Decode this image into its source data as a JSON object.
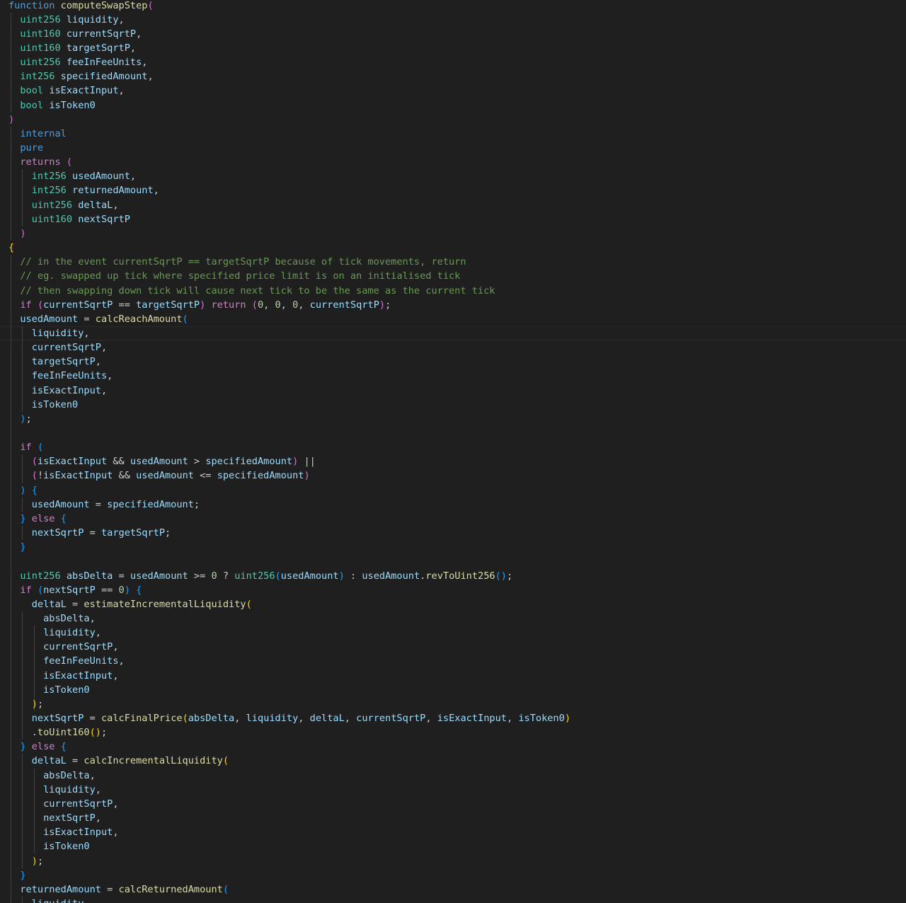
{
  "theme": {
    "background": "#1f1f1f",
    "colors": {
      "kw": "#569cd6",
      "ctrl": "#c586c0",
      "type": "#4ec9b0",
      "var": "#9cdcfe",
      "fn": "#dcdcaa",
      "num": "#b5cea8",
      "cmt": "#6a9955",
      "p1": "#da70d6",
      "p2": "#179fff",
      "p3": "#ffd700",
      "txt": "#cccccc"
    }
  },
  "editor": {
    "lines": [
      [
        [
          "kw",
          "function"
        ],
        [
          "txt",
          " "
        ],
        [
          "fn",
          "computeSwapStep"
        ],
        [
          "p1",
          "("
        ]
      ],
      [
        [
          "txt",
          "  "
        ],
        [
          "type",
          "uint256"
        ],
        [
          "txt",
          " "
        ],
        [
          "var",
          "liquidity"
        ],
        [
          "txt",
          ","
        ]
      ],
      [
        [
          "txt",
          "  "
        ],
        [
          "type",
          "uint160"
        ],
        [
          "txt",
          " "
        ],
        [
          "var",
          "currentSqrtP"
        ],
        [
          "txt",
          ","
        ]
      ],
      [
        [
          "txt",
          "  "
        ],
        [
          "type",
          "uint160"
        ],
        [
          "txt",
          " "
        ],
        [
          "var",
          "targetSqrtP"
        ],
        [
          "txt",
          ","
        ]
      ],
      [
        [
          "txt",
          "  "
        ],
        [
          "type",
          "uint256"
        ],
        [
          "txt",
          " "
        ],
        [
          "var",
          "feeInFeeUnits"
        ],
        [
          "txt",
          ","
        ]
      ],
      [
        [
          "txt",
          "  "
        ],
        [
          "type",
          "int256"
        ],
        [
          "txt",
          " "
        ],
        [
          "var",
          "specifiedAmount"
        ],
        [
          "txt",
          ","
        ]
      ],
      [
        [
          "txt",
          "  "
        ],
        [
          "type",
          "bool"
        ],
        [
          "txt",
          " "
        ],
        [
          "var",
          "isExactInput"
        ],
        [
          "txt",
          ","
        ]
      ],
      [
        [
          "txt",
          "  "
        ],
        [
          "type",
          "bool"
        ],
        [
          "txt",
          " "
        ],
        [
          "var",
          "isToken0"
        ]
      ],
      [
        [
          "p1",
          ")"
        ]
      ],
      [
        [
          "txt",
          "  "
        ],
        [
          "kw",
          "internal"
        ]
      ],
      [
        [
          "txt",
          "  "
        ],
        [
          "kw",
          "pure"
        ]
      ],
      [
        [
          "txt",
          "  "
        ],
        [
          "ctrl",
          "returns"
        ],
        [
          "txt",
          " "
        ],
        [
          "p1",
          "("
        ]
      ],
      [
        [
          "txt",
          "    "
        ],
        [
          "type",
          "int256"
        ],
        [
          "txt",
          " "
        ],
        [
          "var",
          "usedAmount"
        ],
        [
          "txt",
          ","
        ]
      ],
      [
        [
          "txt",
          "    "
        ],
        [
          "type",
          "int256"
        ],
        [
          "txt",
          " "
        ],
        [
          "var",
          "returnedAmount"
        ],
        [
          "txt",
          ","
        ]
      ],
      [
        [
          "txt",
          "    "
        ],
        [
          "type",
          "uint256"
        ],
        [
          "txt",
          " "
        ],
        [
          "var",
          "deltaL"
        ],
        [
          "txt",
          ","
        ]
      ],
      [
        [
          "txt",
          "    "
        ],
        [
          "type",
          "uint160"
        ],
        [
          "txt",
          " "
        ],
        [
          "var",
          "nextSqrtP"
        ]
      ],
      [
        [
          "txt",
          "  "
        ],
        [
          "p1",
          ")"
        ]
      ],
      [
        [
          "p3",
          "{"
        ]
      ],
      [
        [
          "txt",
          "  "
        ],
        [
          "cmt",
          "// in the event currentSqrtP == targetSqrtP because of tick movements, return"
        ]
      ],
      [
        [
          "txt",
          "  "
        ],
        [
          "cmt",
          "// eg. swapped up tick where specified price limit is on an initialised tick"
        ]
      ],
      [
        [
          "txt",
          "  "
        ],
        [
          "cmt",
          "// then swapping down tick will cause next tick to be the same as the current tick"
        ]
      ],
      [
        [
          "txt",
          "  "
        ],
        [
          "ctrl",
          "if"
        ],
        [
          "txt",
          " "
        ],
        [
          "p1",
          "("
        ],
        [
          "var",
          "currentSqrtP"
        ],
        [
          "txt",
          " == "
        ],
        [
          "var",
          "targetSqrtP"
        ],
        [
          "p1",
          ")"
        ],
        [
          "txt",
          " "
        ],
        [
          "ctrl",
          "return"
        ],
        [
          "txt",
          " "
        ],
        [
          "p1",
          "("
        ],
        [
          "num",
          "0"
        ],
        [
          "txt",
          ", "
        ],
        [
          "num",
          "0"
        ],
        [
          "txt",
          ", "
        ],
        [
          "num",
          "0"
        ],
        [
          "txt",
          ", "
        ],
        [
          "var",
          "currentSqrtP"
        ],
        [
          "p1",
          ")"
        ],
        [
          "txt",
          ";"
        ]
      ],
      [
        [
          "txt",
          "  "
        ],
        [
          "var",
          "usedAmount"
        ],
        [
          "txt",
          " = "
        ],
        [
          "fn",
          "calcReachAmount"
        ],
        [
          "p2",
          "("
        ]
      ],
      [
        [
          "txt",
          "    "
        ],
        [
          "var",
          "liquidity"
        ],
        [
          "txt",
          ","
        ]
      ],
      [
        [
          "txt",
          "    "
        ],
        [
          "var",
          "currentSqrtP"
        ],
        [
          "txt",
          ","
        ]
      ],
      [
        [
          "txt",
          "    "
        ],
        [
          "var",
          "targetSqrtP"
        ],
        [
          "txt",
          ","
        ]
      ],
      [
        [
          "txt",
          "    "
        ],
        [
          "var",
          "feeInFeeUnits"
        ],
        [
          "txt",
          ","
        ]
      ],
      [
        [
          "txt",
          "    "
        ],
        [
          "var",
          "isExactInput"
        ],
        [
          "txt",
          ","
        ]
      ],
      [
        [
          "txt",
          "    "
        ],
        [
          "var",
          "isToken0"
        ]
      ],
      [
        [
          "txt",
          "  "
        ],
        [
          "p2",
          ")"
        ],
        [
          "txt",
          ";"
        ]
      ],
      [],
      [
        [
          "txt",
          "  "
        ],
        [
          "ctrl",
          "if"
        ],
        [
          "txt",
          " "
        ],
        [
          "p2",
          "("
        ]
      ],
      [
        [
          "txt",
          "    "
        ],
        [
          "p1",
          "("
        ],
        [
          "var",
          "isExactInput"
        ],
        [
          "txt",
          " && "
        ],
        [
          "var",
          "usedAmount"
        ],
        [
          "txt",
          " > "
        ],
        [
          "var",
          "specifiedAmount"
        ],
        [
          "p1",
          ")"
        ],
        [
          "txt",
          " ||"
        ]
      ],
      [
        [
          "txt",
          "    "
        ],
        [
          "p1",
          "("
        ],
        [
          "txt",
          "!"
        ],
        [
          "var",
          "isExactInput"
        ],
        [
          "txt",
          " && "
        ],
        [
          "var",
          "usedAmount"
        ],
        [
          "txt",
          " <= "
        ],
        [
          "var",
          "specifiedAmount"
        ],
        [
          "p1",
          ")"
        ]
      ],
      [
        [
          "txt",
          "  "
        ],
        [
          "p2",
          ")"
        ],
        [
          "txt",
          " "
        ],
        [
          "p2",
          "{"
        ]
      ],
      [
        [
          "txt",
          "    "
        ],
        [
          "var",
          "usedAmount"
        ],
        [
          "txt",
          " = "
        ],
        [
          "var",
          "specifiedAmount"
        ],
        [
          "txt",
          ";"
        ]
      ],
      [
        [
          "txt",
          "  "
        ],
        [
          "p2",
          "}"
        ],
        [
          "txt",
          " "
        ],
        [
          "ctrl",
          "else"
        ],
        [
          "txt",
          " "
        ],
        [
          "p2",
          "{"
        ]
      ],
      [
        [
          "txt",
          "    "
        ],
        [
          "var",
          "nextSqrtP"
        ],
        [
          "txt",
          " = "
        ],
        [
          "var",
          "targetSqrtP"
        ],
        [
          "txt",
          ";"
        ]
      ],
      [
        [
          "txt",
          "  "
        ],
        [
          "p2",
          "}"
        ]
      ],
      [],
      [
        [
          "txt",
          "  "
        ],
        [
          "type",
          "uint256"
        ],
        [
          "txt",
          " "
        ],
        [
          "var",
          "absDelta"
        ],
        [
          "txt",
          " = "
        ],
        [
          "var",
          "usedAmount"
        ],
        [
          "txt",
          " >= "
        ],
        [
          "num",
          "0"
        ],
        [
          "txt",
          " ? "
        ],
        [
          "type",
          "uint256"
        ],
        [
          "p2",
          "("
        ],
        [
          "var",
          "usedAmount"
        ],
        [
          "p2",
          ")"
        ],
        [
          "txt",
          " : "
        ],
        [
          "var",
          "usedAmount"
        ],
        [
          "txt",
          "."
        ],
        [
          "fn",
          "revToUint256"
        ],
        [
          "p2",
          "()"
        ],
        [
          "txt",
          ";"
        ]
      ],
      [
        [
          "txt",
          "  "
        ],
        [
          "ctrl",
          "if"
        ],
        [
          "txt",
          " "
        ],
        [
          "p2",
          "("
        ],
        [
          "var",
          "nextSqrtP"
        ],
        [
          "txt",
          " == "
        ],
        [
          "num",
          "0"
        ],
        [
          "p2",
          ")"
        ],
        [
          "txt",
          " "
        ],
        [
          "p2",
          "{"
        ]
      ],
      [
        [
          "txt",
          "    "
        ],
        [
          "var",
          "deltaL"
        ],
        [
          "txt",
          " = "
        ],
        [
          "fn",
          "estimateIncrementalLiquidity"
        ],
        [
          "p3",
          "("
        ]
      ],
      [
        [
          "txt",
          "      "
        ],
        [
          "var",
          "absDelta"
        ],
        [
          "txt",
          ","
        ]
      ],
      [
        [
          "txt",
          "      "
        ],
        [
          "var",
          "liquidity"
        ],
        [
          "txt",
          ","
        ]
      ],
      [
        [
          "txt",
          "      "
        ],
        [
          "var",
          "currentSqrtP"
        ],
        [
          "txt",
          ","
        ]
      ],
      [
        [
          "txt",
          "      "
        ],
        [
          "var",
          "feeInFeeUnits"
        ],
        [
          "txt",
          ","
        ]
      ],
      [
        [
          "txt",
          "      "
        ],
        [
          "var",
          "isExactInput"
        ],
        [
          "txt",
          ","
        ]
      ],
      [
        [
          "txt",
          "      "
        ],
        [
          "var",
          "isToken0"
        ]
      ],
      [
        [
          "txt",
          "    "
        ],
        [
          "p3",
          ")"
        ],
        [
          "txt",
          ";"
        ]
      ],
      [
        [
          "txt",
          "    "
        ],
        [
          "var",
          "nextSqrtP"
        ],
        [
          "txt",
          " = "
        ],
        [
          "fn",
          "calcFinalPrice"
        ],
        [
          "p3",
          "("
        ],
        [
          "var",
          "absDelta"
        ],
        [
          "txt",
          ", "
        ],
        [
          "var",
          "liquidity"
        ],
        [
          "txt",
          ", "
        ],
        [
          "var",
          "deltaL"
        ],
        [
          "txt",
          ", "
        ],
        [
          "var",
          "currentSqrtP"
        ],
        [
          "txt",
          ", "
        ],
        [
          "var",
          "isExactInput"
        ],
        [
          "txt",
          ", "
        ],
        [
          "var",
          "isToken0"
        ],
        [
          "p3",
          ")"
        ]
      ],
      [
        [
          "txt",
          "    ."
        ],
        [
          "fn",
          "toUint160"
        ],
        [
          "p3",
          "()"
        ],
        [
          "txt",
          ";"
        ]
      ],
      [
        [
          "txt",
          "  "
        ],
        [
          "p2",
          "}"
        ],
        [
          "txt",
          " "
        ],
        [
          "ctrl",
          "else"
        ],
        [
          "txt",
          " "
        ],
        [
          "p2",
          "{"
        ]
      ],
      [
        [
          "txt",
          "    "
        ],
        [
          "var",
          "deltaL"
        ],
        [
          "txt",
          " = "
        ],
        [
          "fn",
          "calcIncrementalLiquidity"
        ],
        [
          "p3",
          "("
        ]
      ],
      [
        [
          "txt",
          "      "
        ],
        [
          "var",
          "absDelta"
        ],
        [
          "txt",
          ","
        ]
      ],
      [
        [
          "txt",
          "      "
        ],
        [
          "var",
          "liquidity"
        ],
        [
          "txt",
          ","
        ]
      ],
      [
        [
          "txt",
          "      "
        ],
        [
          "var",
          "currentSqrtP"
        ],
        [
          "txt",
          ","
        ]
      ],
      [
        [
          "txt",
          "      "
        ],
        [
          "var",
          "nextSqrtP"
        ],
        [
          "txt",
          ","
        ]
      ],
      [
        [
          "txt",
          "      "
        ],
        [
          "var",
          "isExactInput"
        ],
        [
          "txt",
          ","
        ]
      ],
      [
        [
          "txt",
          "      "
        ],
        [
          "var",
          "isToken0"
        ]
      ],
      [
        [
          "txt",
          "    "
        ],
        [
          "p3",
          ")"
        ],
        [
          "txt",
          ";"
        ]
      ],
      [
        [
          "txt",
          "  "
        ],
        [
          "p2",
          "}"
        ]
      ],
      [
        [
          "txt",
          "  "
        ],
        [
          "var",
          "returnedAmount"
        ],
        [
          "txt",
          " = "
        ],
        [
          "fn",
          "calcReturnedAmount"
        ],
        [
          "p2",
          "("
        ]
      ],
      [
        [
          "txt",
          "    "
        ],
        [
          "var",
          "liquidity"
        ],
        [
          "txt",
          ","
        ]
      ]
    ]
  }
}
